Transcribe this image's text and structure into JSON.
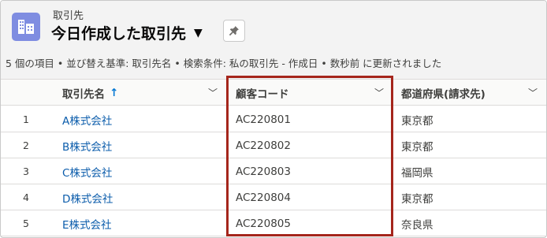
{
  "header": {
    "object_label": "取引先",
    "list_title": "今日作成した取引先",
    "icon": "table-grid-icon",
    "icon_color": "#7f8de1",
    "pin_icon": "pushpin-icon",
    "status_text": "5 個の項目 • 並び替え基準: 取引先名 • 検索条件: 私の取引先 - 作成日 • 数秒前 に更新されました"
  },
  "table": {
    "columns": [
      {
        "label": "取引先名",
        "sort_icon": "↑"
      },
      {
        "label": "顧客コード"
      },
      {
        "label": "都道府県(請求先)"
      }
    ],
    "rows": [
      {
        "num": "1",
        "name": "A株式会社",
        "code": "AC220801",
        "pref": "東京都"
      },
      {
        "num": "2",
        "name": "B株式会社",
        "code": "AC220802",
        "pref": "東京都"
      },
      {
        "num": "3",
        "name": "C株式会社",
        "code": "AC220803",
        "pref": "福岡県"
      },
      {
        "num": "4",
        "name": "D株式会社",
        "code": "AC220804",
        "pref": "東京都"
      },
      {
        "num": "5",
        "name": "E株式会社",
        "code": "AC220805",
        "pref": "奈良県"
      }
    ]
  },
  "colors": {
    "link": "#0b5cab",
    "highlight_border": "#a5261c",
    "sort_arrow": "#0176d3"
  }
}
